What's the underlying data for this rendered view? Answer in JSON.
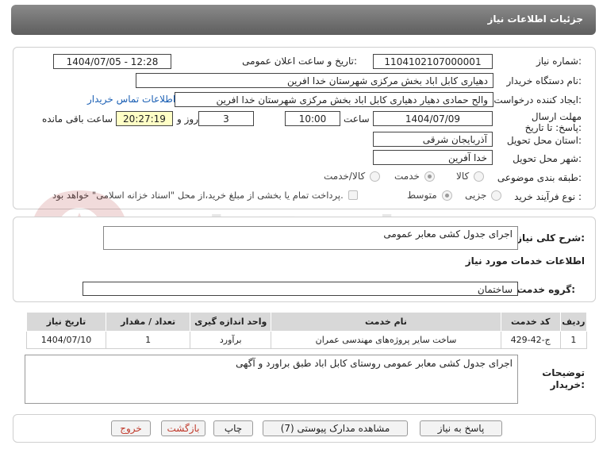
{
  "header": {
    "title": "جزئیات اطلاعات نیاز"
  },
  "fields": {
    "need_number_label": "شماره نیاز:",
    "need_number": "1104102107000001",
    "announce_label": "تاریخ و ساعت اعلان عمومی:",
    "announce_value": "1404/07/05 - 12:28",
    "buyer_org_label": "نام دستگاه خریدار:",
    "buyer_org": "دهیاری کابل اباد بخش مرکزی شهرستان خدا افرین",
    "creator_label": "ایجاد کننده درخواست:",
    "creator": "والح حمادی دهیار  دهیاری کابل اباد بخش مرکزی شهرستان خدا افرین",
    "contact_link": "اطلاعات تماس خریدار",
    "deadline_label": "مهلت ارسال پاسخ: تا تاریخ:",
    "deadline_date": "1404/07/09",
    "time_label": "ساعت",
    "deadline_time": "10:00",
    "days_value": "3",
    "days_label": "روز و",
    "remaining_time": "20:27:19",
    "remaining_label": "ساعت باقی مانده",
    "province_label": "استان محل تحویل:",
    "province": "آذربایجان شرقی",
    "city_label": "شهر محل تحویل:",
    "city": "خدا آفرین",
    "category_label": "طبقه بندی موضوعی:",
    "category_options": [
      "کالا",
      "خدمت",
      "کالا/خدمت"
    ],
    "process_label": "نوع فرآیند خرید :",
    "process_options": [
      "جزیی",
      "متوسط"
    ],
    "payment_note": "پرداخت تمام یا بخشی از مبلغ خرید،از محل \"اسناد خزانه اسلامی\" خواهد بود."
  },
  "summary": {
    "label": "شرح کلی نیاز:",
    "value": "اجرای جدول کشی معابر عمومی"
  },
  "services": {
    "section_title": "اطلاعات خدمات مورد نیاز",
    "group_label": "گروه خدمت:",
    "group_value": "ساختمان",
    "table": {
      "headers": [
        "ردیف",
        "کد خدمت",
        "نام خدمت",
        "واحد اندازه گیری",
        "تعداد / مقدار",
        "تاریخ نیاز"
      ],
      "rows": [
        [
          "1",
          "ج-42-429",
          "ساخت سایر پروژه‌های مهندسی عمران",
          "برآورد",
          "1",
          "1404/07/10"
        ]
      ]
    }
  },
  "buyer_notes": {
    "label": "توضیحات خریدار:",
    "value": "اجرای جدول کشی معابر عمومی روستای کابل اباد طبق براورد و آگهی"
  },
  "buttons": {
    "reply": "پاسخ به نیاز",
    "attachments": "مشاهده مدارک پیوستی (7)",
    "print": "چاپ",
    "back": "بازگشت",
    "exit": "خروج"
  },
  "watermark": {
    "text": "AriaTender.net"
  },
  "colors": {
    "header": "#6e6e6e",
    "link": "#1a5fb4",
    "highlight": "#ffffc6",
    "danger": "#c0392b"
  }
}
